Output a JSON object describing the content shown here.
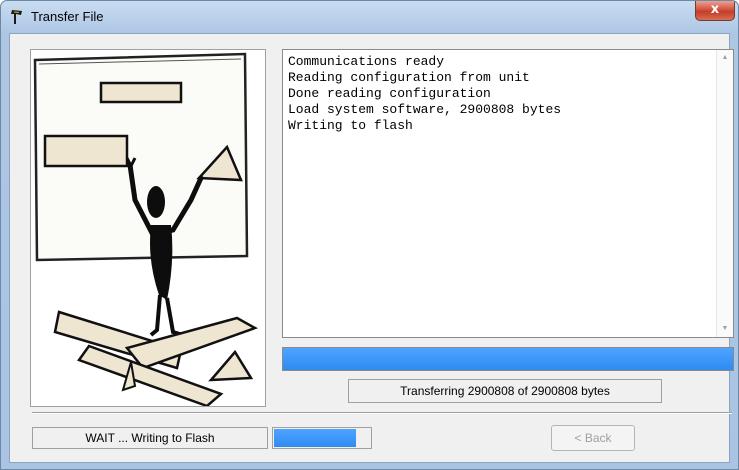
{
  "window": {
    "title": "Transfer File",
    "close_glyph": "x"
  },
  "log": {
    "lines": [
      "Communications ready",
      "Reading configuration from unit",
      "Done reading configuration",
      "Load system software, 2900808 bytes",
      "Writing to flash"
    ]
  },
  "progress": {
    "main_fraction": 1.0,
    "small_fraction": 0.85,
    "main_status": "Transferring 2900808 of 2900808 bytes",
    "wait_status": "WAIT ... Writing to Flash"
  },
  "buttons": {
    "back_label": "< Back"
  },
  "colors": {
    "progress": "#3a93f8"
  }
}
